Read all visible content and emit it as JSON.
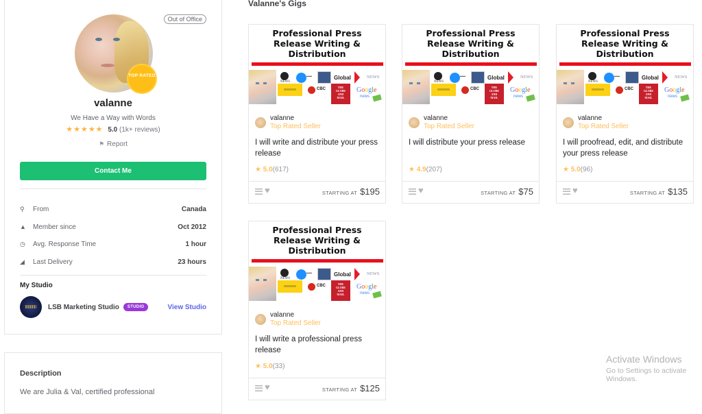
{
  "profile": {
    "status_badge": "Out of Office",
    "seal_text": "TOP RATED",
    "username": "valanne",
    "tagline": "We Have a Way with Words",
    "stars": "★★★★★",
    "rating": "5.0",
    "review_count": "(1k+ reviews)",
    "report_label": "Report",
    "contact_label": "Contact Me",
    "stats": [
      {
        "icon": "location-pin-icon",
        "glyph": "⚲",
        "label": "From",
        "value": "Canada"
      },
      {
        "icon": "user-icon",
        "glyph": "▲",
        "label": "Member since",
        "value": "Oct 2012"
      },
      {
        "icon": "clock-icon",
        "glyph": "◷",
        "label": "Avg. Response Time",
        "value": "1 hour"
      },
      {
        "icon": "paper-plane-icon",
        "glyph": "◢",
        "label": "Last Delivery",
        "value": "23 hours"
      }
    ],
    "studio": {
      "heading": "My Studio",
      "name": "LSB Marketing Studio",
      "badge": "STUDIO",
      "view_label": "View Studio"
    }
  },
  "description": {
    "title": "Description",
    "text": "We are Julia & Val, certified professional"
  },
  "gigs_section": {
    "title": "Valanne's Gigs",
    "price_prefix": "STARTING AT",
    "thumbnail": {
      "title_line1": "Professional Press",
      "title_line2": "Release Writing &",
      "title_line3": "Distribution",
      "logos": [
        "ABC News",
        "CBS",
        "Fox News",
        "Global",
        "CTV News",
        "CBC",
        "The Globe and Mail",
        "Google News"
      ]
    },
    "gigs": [
      {
        "seller": "valanne",
        "level": "Top Rated Seller",
        "title": "I will write and distribute your press release",
        "rating": "5.0",
        "reviews": "(617)",
        "price": "$195"
      },
      {
        "seller": "valanne",
        "level": "Top Rated Seller",
        "title": "I will distribute your press release",
        "rating": "4.9",
        "reviews": "(207)",
        "price": "$75"
      },
      {
        "seller": "valanne",
        "level": "Top Rated Seller",
        "title": "I will proofread, edit, and distribute your press release",
        "rating": "5.0",
        "reviews": "(96)",
        "price": "$135"
      },
      {
        "seller": "valanne",
        "level": "Top Rated Seller",
        "title": "I will write a professional press release",
        "rating": "5.0",
        "reviews": "(33)",
        "price": "$125"
      }
    ]
  },
  "watermark": {
    "line1": "Activate Windows",
    "line2": "Go to Settings to activate Windows."
  },
  "colors": {
    "accent_green": "#1dbf73",
    "star_yellow": "#ffb33e",
    "top_rated_orange": "#ffbe5b",
    "studio_purple": "#9b38d9",
    "link_blue": "#5b66e8"
  }
}
